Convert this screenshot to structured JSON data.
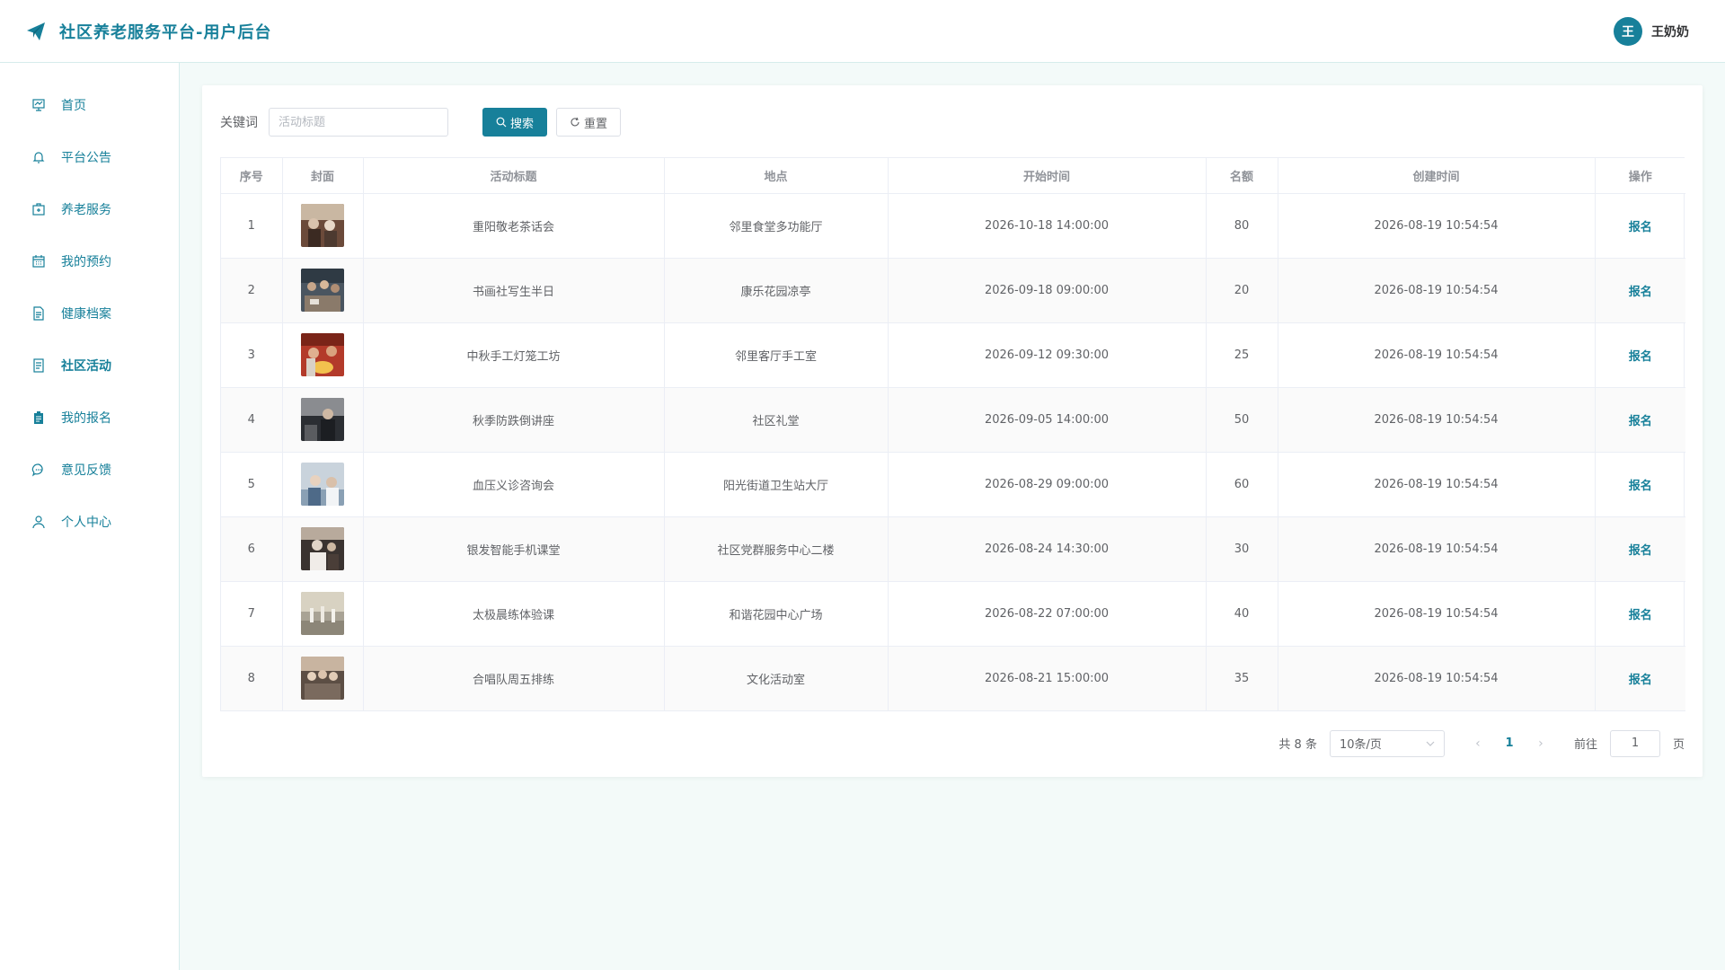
{
  "header": {
    "title": "社区养老服务平台-用户后台",
    "avatar_letter": "王",
    "user_name": "王奶奶"
  },
  "sidebar": {
    "items": [
      {
        "label": "首页",
        "icon": "presentation-icon"
      },
      {
        "label": "平台公告",
        "icon": "bell-icon"
      },
      {
        "label": "养老服务",
        "icon": "first-aid-kit-icon"
      },
      {
        "label": "我的预约",
        "icon": "calendar-icon"
      },
      {
        "label": "健康档案",
        "icon": "document-icon"
      },
      {
        "label": "社区活动",
        "icon": "tickets-icon",
        "active": true
      },
      {
        "label": "我的报名",
        "icon": "clipboard-icon"
      },
      {
        "label": "意见反馈",
        "icon": "chat-icon"
      },
      {
        "label": "个人中心",
        "icon": "user-icon"
      }
    ]
  },
  "toolbar": {
    "keyword_label": "关键词",
    "keyword_placeholder": "活动标题",
    "search_label": "搜索",
    "reset_label": "重置"
  },
  "table": {
    "columns": [
      "序号",
      "封面",
      "活动标题",
      "地点",
      "开始时间",
      "名额",
      "创建时间",
      "操作"
    ],
    "rows": [
      {
        "no": "1",
        "title": "重阳敬老茶话会",
        "place": "邻里食堂多功能厅",
        "start": "2026-10-18 14:00:00",
        "quota": "80",
        "created": "2026-08-19 10:54:54",
        "action": "报名"
      },
      {
        "no": "2",
        "title": "书画社写生半日",
        "place": "康乐花园凉亭",
        "start": "2026-09-18 09:00:00",
        "quota": "20",
        "created": "2026-08-19 10:54:54",
        "action": "报名"
      },
      {
        "no": "3",
        "title": "中秋手工灯笼工坊",
        "place": "邻里客厅手工室",
        "start": "2026-09-12 09:30:00",
        "quota": "25",
        "created": "2026-08-19 10:54:54",
        "action": "报名"
      },
      {
        "no": "4",
        "title": "秋季防跌倒讲座",
        "place": "社区礼堂",
        "start": "2026-09-05 14:00:00",
        "quota": "50",
        "created": "2026-08-19 10:54:54",
        "action": "报名"
      },
      {
        "no": "5",
        "title": "血压义诊咨询会",
        "place": "阳光街道卫生站大厅",
        "start": "2026-08-29 09:00:00",
        "quota": "60",
        "created": "2026-08-19 10:54:54",
        "action": "报名"
      },
      {
        "no": "6",
        "title": "银发智能手机课堂",
        "place": "社区党群服务中心二楼",
        "start": "2026-08-24 14:30:00",
        "quota": "30",
        "created": "2026-08-19 10:54:54",
        "action": "报名"
      },
      {
        "no": "7",
        "title": "太极晨练体验课",
        "place": "和谐花园中心广场",
        "start": "2026-08-22 07:00:00",
        "quota": "40",
        "created": "2026-08-19 10:54:54",
        "action": "报名"
      },
      {
        "no": "8",
        "title": "合唱队周五排练",
        "place": "文化活动室",
        "start": "2026-08-21 15:00:00",
        "quota": "35",
        "created": "2026-08-19 10:54:54",
        "action": "报名"
      }
    ]
  },
  "pagination": {
    "total_text": "共 8 条",
    "page_size": "10条/页",
    "current_page": "1",
    "goto_label": "前往",
    "goto_value": "1",
    "page_suffix": "页"
  },
  "colors": {
    "accent": "#17809a",
    "sidebar_border": "#d6ecec",
    "background": "#f3faf9"
  }
}
